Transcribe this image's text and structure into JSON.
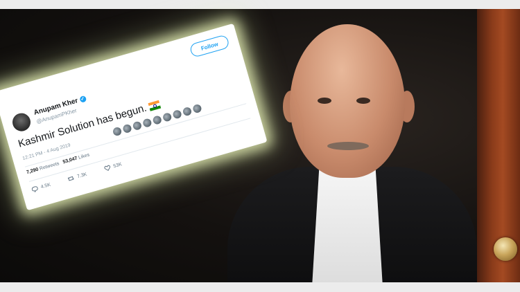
{
  "tweet": {
    "author_name": "Anupam Kher",
    "author_handle": "@AnupamPKher",
    "follow_label": "Follow",
    "text": "Kashmir Solution has begun.",
    "timestamp": "12:21 PM - 4 Aug 2019",
    "retweets_count": "7,290",
    "retweets_label": "Retweets",
    "likes_count": "53,047",
    "likes_label": "Likes",
    "reply_count": "4.5K",
    "retweet_count_action": "7.3K",
    "like_count_action": "53K"
  },
  "icons": {
    "verified": "verified-badge-icon",
    "flag": "india-flag-emoji",
    "reply": "reply-icon",
    "retweet": "retweet-icon",
    "like": "heart-icon"
  },
  "colors": {
    "twitter_blue": "#1da1f2",
    "card_glow": "#f0fabe",
    "background": "#14110f"
  }
}
